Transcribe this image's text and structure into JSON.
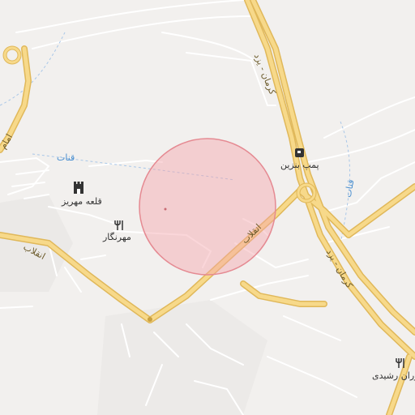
{
  "map": {
    "selection_circle_color": "#f4a3aa",
    "major_road_color": "#f3d27a",
    "minor_road_color": "#ffffff",
    "water_label_color": "#4a8fd0"
  },
  "labels": {
    "highway_yazd_kerman_north": "کرمان - یزد",
    "highway_yazd_kerman_south": "کرمان - یزد",
    "road_enghelab_center": "انقلاب",
    "road_enghelab_west": "انقلاب",
    "road_emam": "امام",
    "qanat_west": "قنات",
    "qanat_east": "قنات",
    "gas_station": "پمپ بنزین",
    "mehriz_castle": "قلعه مهریز",
    "mehrnegar_restaurant": "مهرنگار",
    "rashidi_restaurant": "وران رشیدی"
  },
  "icons": {
    "gas_station": "fuel-pump-icon",
    "castle": "castle-icon",
    "restaurant": "fork-knife-icon"
  }
}
